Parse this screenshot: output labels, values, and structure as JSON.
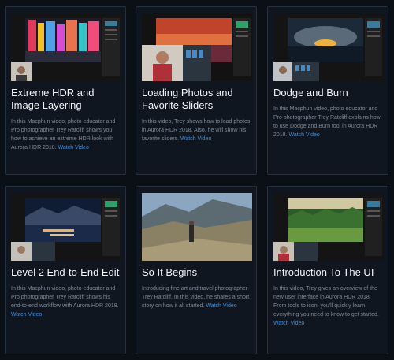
{
  "cards": [
    {
      "title": "Extreme HDR and Image Layering",
      "description": "In this Macphun video, photo educator and Pro photographer Trey Ratcliff shows you how to achieve an extreme HDR look with Aurora HDR 2018.",
      "link": "Watch Video"
    },
    {
      "title": "Loading Photos and Favorite Sliders",
      "description": "In this video, Trey shows how to load photos in Aurora HDR 2018. Also, he will show his favorite sliders.",
      "link": "Watch Video"
    },
    {
      "title": "Dodge and Burn",
      "description": "In this Macphun video, photo educator and Pro photographer Trey Ratcliff explains how to use Dodge and Burn tool in Aurora HDR 2018.",
      "link": "Watch Video"
    },
    {
      "title": "Level 2 End-to-End Edit",
      "description": "In this Macphun video, photo educator and Pro photographer Trey Ratcliff shows his end-to-end workflow with Aurora HDR 2018.",
      "link": "Watch Video"
    },
    {
      "title": "So It Begins",
      "description": "Introducing fine art and travel photographer Trey Ratcliff. In this video, he shares a short story on how it all started.",
      "link": "Watch Video"
    },
    {
      "title": "Introduction To The UI",
      "description": "In this video, Trey gives an overview of the new user interface in Aurora HDR 2018. From tools to icon, you'll quickly learn everything you need to know to get started.",
      "link": "Watch Video"
    }
  ],
  "colors": {
    "background": "#0b1017",
    "card": "#0f1620",
    "link": "#3f8ed8"
  }
}
